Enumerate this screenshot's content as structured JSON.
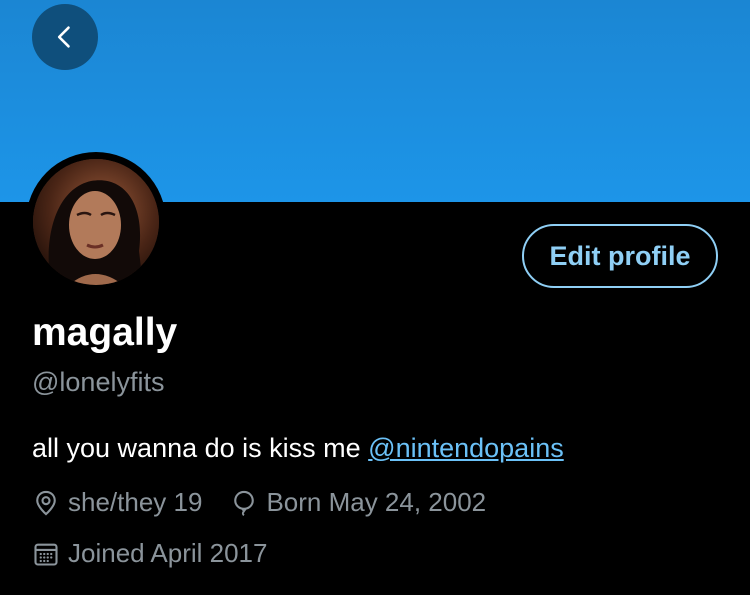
{
  "header": {
    "back_icon": "chevron-left-icon",
    "banner_color": "#1d95e8"
  },
  "profile": {
    "display_name": "magally",
    "handle": "@lonelyfits",
    "bio_text": "all you wanna do is kiss me ",
    "bio_mention": "@nintendopains",
    "edit_label": "Edit profile",
    "pronouns": "she/they 19",
    "birthday": "Born May 24, 2002",
    "joined": "Joined April 2017"
  },
  "colors": {
    "accent": "#8fcff5",
    "link": "#6bc1f7",
    "muted": "#8b949b",
    "background": "#000000"
  }
}
